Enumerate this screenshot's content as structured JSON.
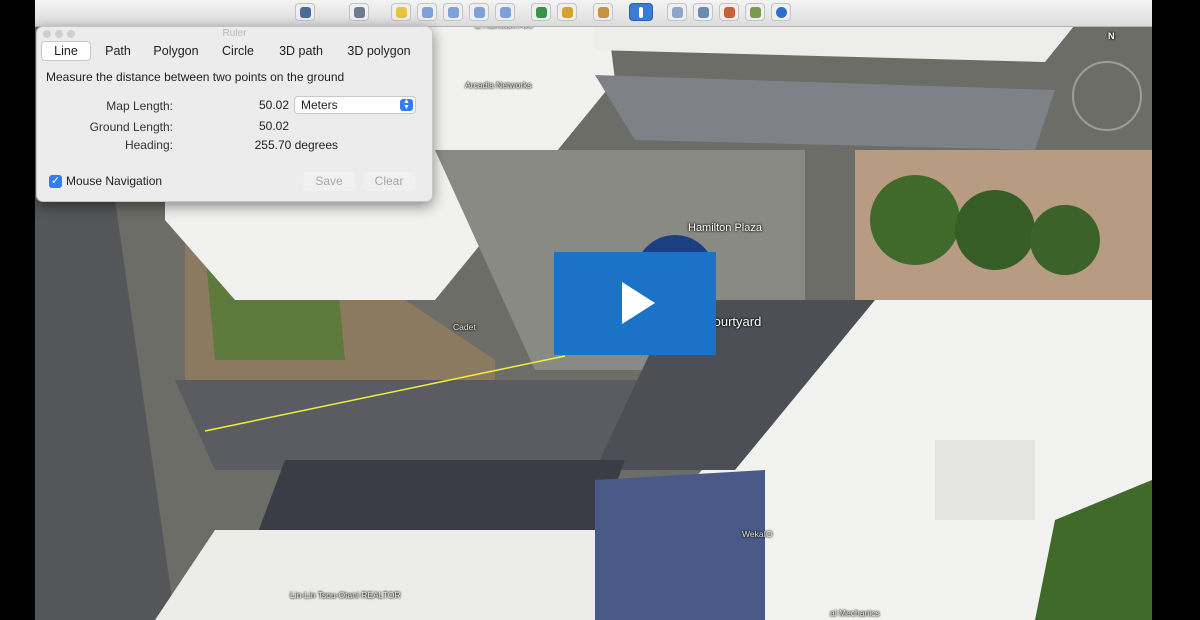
{
  "window_title": "Ruler",
  "tabs": [
    {
      "label": "Line",
      "active": true
    },
    {
      "label": "Path"
    },
    {
      "label": "Polygon"
    },
    {
      "label": "Circle"
    },
    {
      "label": "3D path"
    },
    {
      "label": "3D polygon"
    }
  ],
  "instruction": "Measure the distance between two points on the ground",
  "map_length": {
    "label": "Map Length:",
    "value": "50.02"
  },
  "unit_select": {
    "value": "Meters"
  },
  "ground_length": {
    "label": "Ground Length:",
    "value": "50.02"
  },
  "heading": {
    "label": "Heading:",
    "value": "255.70 degrees"
  },
  "mouse_navigation": {
    "label": "Mouse Navigation",
    "checked": true
  },
  "buttons": {
    "save": "Save",
    "clear": "Clear"
  },
  "map_labels": {
    "hamilton_plaza": "Hamilton Plaza",
    "hq_courtyard": "HQ courtyard",
    "arcadia_networks": "Arcadia Networks",
    "cadet": "Cadet",
    "wekaio": "WekaIO",
    "realtor": "Lin-Lin Tsou-Otani REALTOR",
    "north": "N",
    "top_street": "& Hamilton Ave",
    "bottom_right": "al Mechanics"
  },
  "video_overlay": {
    "icon": "play-icon"
  },
  "colors": {
    "accent": "#1a73c6",
    "measure_line": "#f1ee3c",
    "checkbox": "#2f7cf6"
  }
}
